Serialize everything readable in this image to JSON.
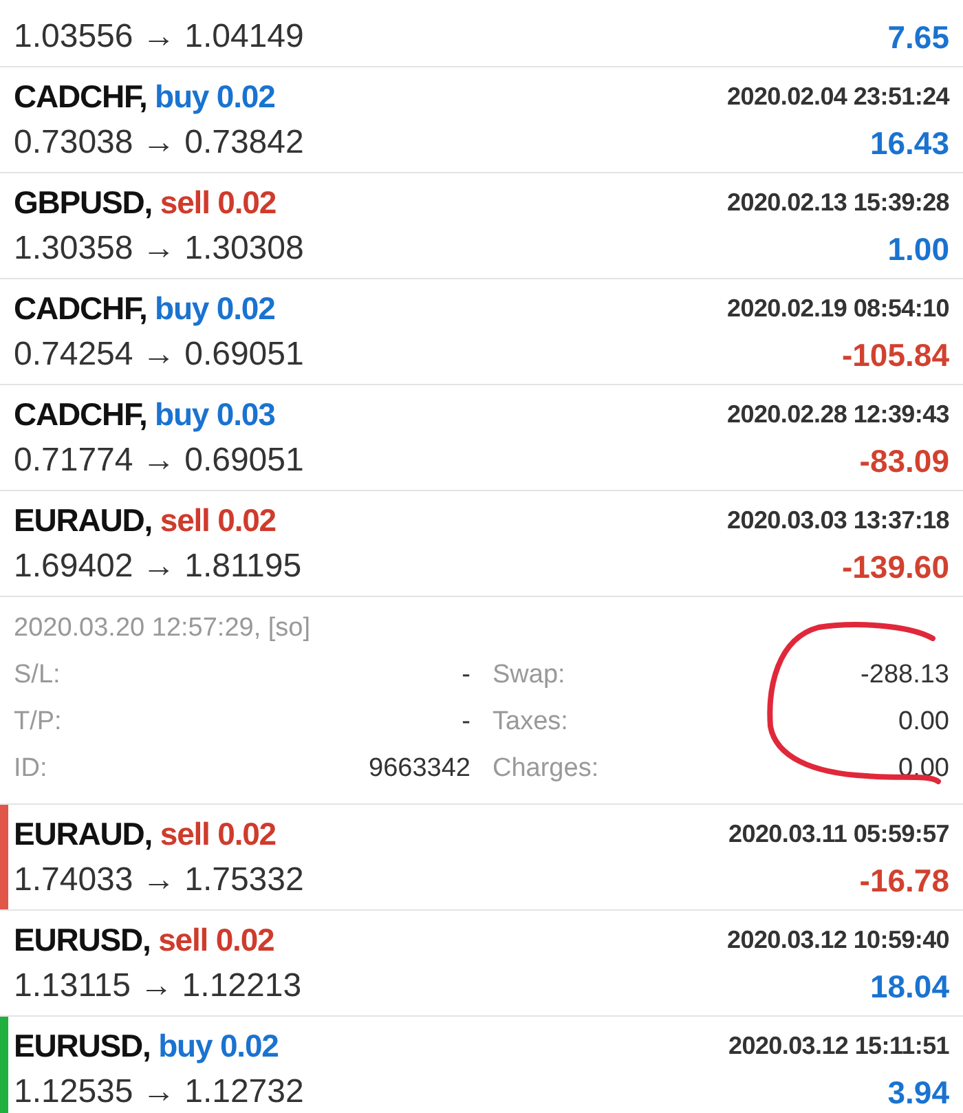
{
  "trades": [
    {
      "prices": "1.03556 → 1.04149",
      "profit": "7.65",
      "kind": "gain"
    },
    {
      "symbol": "CADCHF,",
      "side": "buy",
      "volume": "0.02",
      "time": "2020.02.04 23:51:24",
      "prices": "0.73038 → 0.73842",
      "profit": "16.43",
      "kind": "gain"
    },
    {
      "symbol": "GBPUSD,",
      "side": "sell",
      "volume": "0.02",
      "time": "2020.02.13 15:39:28",
      "prices": "1.30358 → 1.30308",
      "profit": "1.00",
      "kind": "gain"
    },
    {
      "symbol": "CADCHF,",
      "side": "buy",
      "volume": "0.02",
      "time": "2020.02.19 08:54:10",
      "prices": "0.74254 → 0.69051",
      "profit": "-105.84",
      "kind": "loss"
    },
    {
      "symbol": "CADCHF,",
      "side": "buy",
      "volume": "0.03",
      "time": "2020.02.28 12:39:43",
      "prices": "0.71774 → 0.69051",
      "profit": "-83.09",
      "kind": "loss"
    },
    {
      "symbol": "EURAUD,",
      "side": "sell",
      "volume": "0.02",
      "time": "2020.03.03 13:37:18",
      "prices": "1.69402 → 1.81195",
      "profit": "-139.60",
      "kind": "loss",
      "expanded": true,
      "details": {
        "closed": "2020.03.20 12:57:29, [so]",
        "left": [
          {
            "label": "S/L:",
            "value": "-"
          },
          {
            "label": "T/P:",
            "value": "-"
          },
          {
            "label": "ID:",
            "value": "9663342"
          }
        ],
        "right": [
          {
            "label": "Swap:",
            "value": "-288.13"
          },
          {
            "label": "Taxes:",
            "value": "0.00"
          },
          {
            "label": "Charges:",
            "value": "0.00"
          }
        ]
      }
    },
    {
      "symbol": "EURAUD,",
      "side": "sell",
      "volume": "0.02",
      "time": "2020.03.11 05:59:57",
      "prices": "1.74033 → 1.75332",
      "profit": "-16.78",
      "kind": "loss",
      "color": "#e0574a"
    },
    {
      "symbol": "EURUSD,",
      "side": "sell",
      "volume": "0.02",
      "time": "2020.03.12 10:59:40",
      "prices": "1.13115 → 1.12213",
      "profit": "18.04",
      "kind": "gain"
    },
    {
      "symbol": "EURUSD,",
      "side": "buy",
      "volume": "0.02",
      "time": "2020.03.12 15:11:51",
      "prices": "1.12535 → 1.12732",
      "profit": "3.94",
      "kind": "gain",
      "color": "#1fb040"
    }
  ]
}
